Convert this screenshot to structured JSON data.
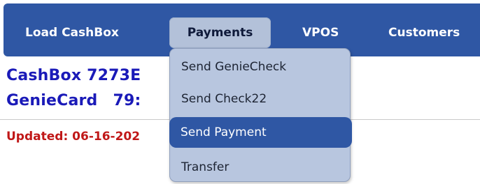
{
  "nav": {
    "items": [
      {
        "label": "Load CashBox"
      },
      {
        "label": "Payments"
      },
      {
        "label": "VPOS"
      },
      {
        "label": "Customers"
      }
    ]
  },
  "info": {
    "cashbox_label": "CashBox",
    "cashbox_number": "7273E",
    "geniecard_label": "GenieCard",
    "geniecard_number": "79:",
    "updated_text": "Updated: 06-16-202"
  },
  "dropdown": {
    "items": [
      {
        "label": "Send GenieCheck"
      },
      {
        "label": "Send Check22"
      },
      {
        "label": "Send Payment",
        "highlighted": true
      },
      {
        "label": "Transfer"
      }
    ]
  },
  "colors": {
    "navbar": "#2f57a4",
    "active_tab": "#b3c1d9",
    "dropdown_bg": "#b8c6df",
    "highlight": "#2f57a4",
    "info_text": "#1a1ab8",
    "updated_text": "#c01818"
  }
}
